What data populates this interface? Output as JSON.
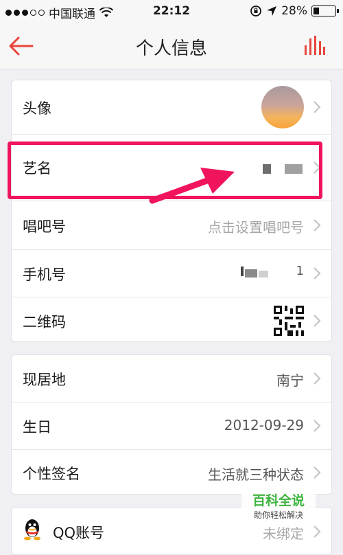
{
  "status_bar": {
    "carrier": "中国联通",
    "time": "22:12",
    "battery": "28%"
  },
  "nav": {
    "title": "个人信息"
  },
  "profile_card": {
    "avatar_label": "头像",
    "stage_name_label": "艺名",
    "changba_id_label": "唱吧号",
    "changba_id_placeholder": "点击设置唱吧号",
    "phone_label": "手机号",
    "phone_visible_end": "1",
    "qrcode_label": "二维码"
  },
  "info_card": {
    "location_label": "现居地",
    "location_value": "南宁",
    "birthday_label": "生日",
    "birthday_value": "2012-09-29",
    "signature_label": "个性签名",
    "signature_value": "生活就三种状态"
  },
  "accounts_card": {
    "qq_label": "QQ账号",
    "qq_value": "未绑定"
  },
  "watermark": {
    "main": "百科全说",
    "sub": "助你轻松解决"
  },
  "colors": {
    "accent": "#e8453c",
    "highlight": "#f0145d",
    "watermark_green": "#3db43d"
  },
  "icons": [
    "back-arrow-icon",
    "bar-chart-icon",
    "chevron-right-icon",
    "qr-code-icon",
    "qq-penguin-icon",
    "wifi-icon",
    "battery-icon",
    "location-arrow-icon",
    "rotation-lock-icon"
  ]
}
